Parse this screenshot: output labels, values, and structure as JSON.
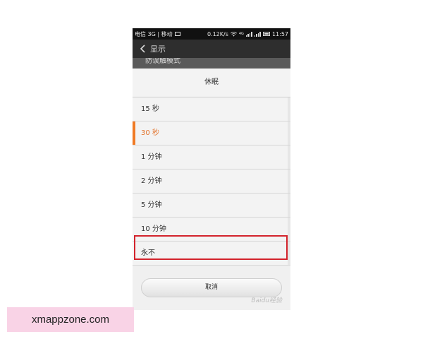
{
  "status_bar": {
    "carrier": "电信 3G | 移动",
    "speed": "0.12K/s",
    "network_small": "4G",
    "time": "11:57"
  },
  "action_bar": {
    "title": "显示"
  },
  "behind_row": {
    "label": "防误触模式"
  },
  "dialog": {
    "title": "休眠",
    "options": [
      {
        "label": "15 秒",
        "selected": false
      },
      {
        "label": "30 秒",
        "selected": true
      },
      {
        "label": "1 分钟",
        "selected": false
      },
      {
        "label": "2 分钟",
        "selected": false
      },
      {
        "label": "5 分钟",
        "selected": false,
        "highlighted": true
      },
      {
        "label": "10 分钟",
        "selected": false
      },
      {
        "label": "永不",
        "selected": false
      }
    ],
    "cancel_label": "取消"
  },
  "watermark": "Baidu经验",
  "site_label": "xmappzone.com",
  "colors": {
    "accent": "#f07a25",
    "selected_text": "#e3742d",
    "highlight_box": "#d3232c",
    "site_label_bg": "#f9d3e6"
  }
}
